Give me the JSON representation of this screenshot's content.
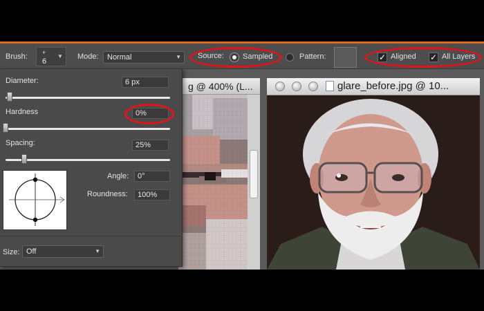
{
  "options_bar": {
    "brush_label": "Brush:",
    "brush_plus": "+",
    "brush_size": "6",
    "mode_label": "Mode:",
    "mode_value": "Normal",
    "source_label": "Source:",
    "sampled_label": "Sampled",
    "pattern_label": "Pattern:",
    "aligned_label": "Aligned",
    "all_layers_label": "All Layers",
    "sampled_selected": true,
    "aligned_checked": true,
    "all_layers_checked": true
  },
  "brush_panel": {
    "diameter_label": "Diameter:",
    "diameter_value": "6 px",
    "diameter_level": 0.02,
    "hardness_label": "Hardness",
    "hardness_value": "0%",
    "hardness_level": 0.0,
    "spacing_label": "Spacing:",
    "spacing_value": "25%",
    "spacing_level": 0.12,
    "angle_label": "Angle:",
    "angle_value": "0°",
    "roundness_label": "Roundness:",
    "roundness_value": "100%",
    "size_label": "Size:",
    "size_value": "Off"
  },
  "documents": [
    {
      "title": "g @ 400% (L..."
    },
    {
      "title": "glare_before.jpg @ 10..."
    }
  ],
  "colors": {
    "highlight_red": "#e0141a",
    "accent_orange": "#d9692a",
    "panel_bg": "#4a4a4a"
  },
  "icons": [
    "chevron-down-icon",
    "checkbox-checked-icon",
    "radio-selected-icon",
    "radio-unselected-icon",
    "close-window-icon",
    "minimize-window-icon",
    "zoom-window-icon",
    "document-icon",
    "brush-preview-icon"
  ]
}
